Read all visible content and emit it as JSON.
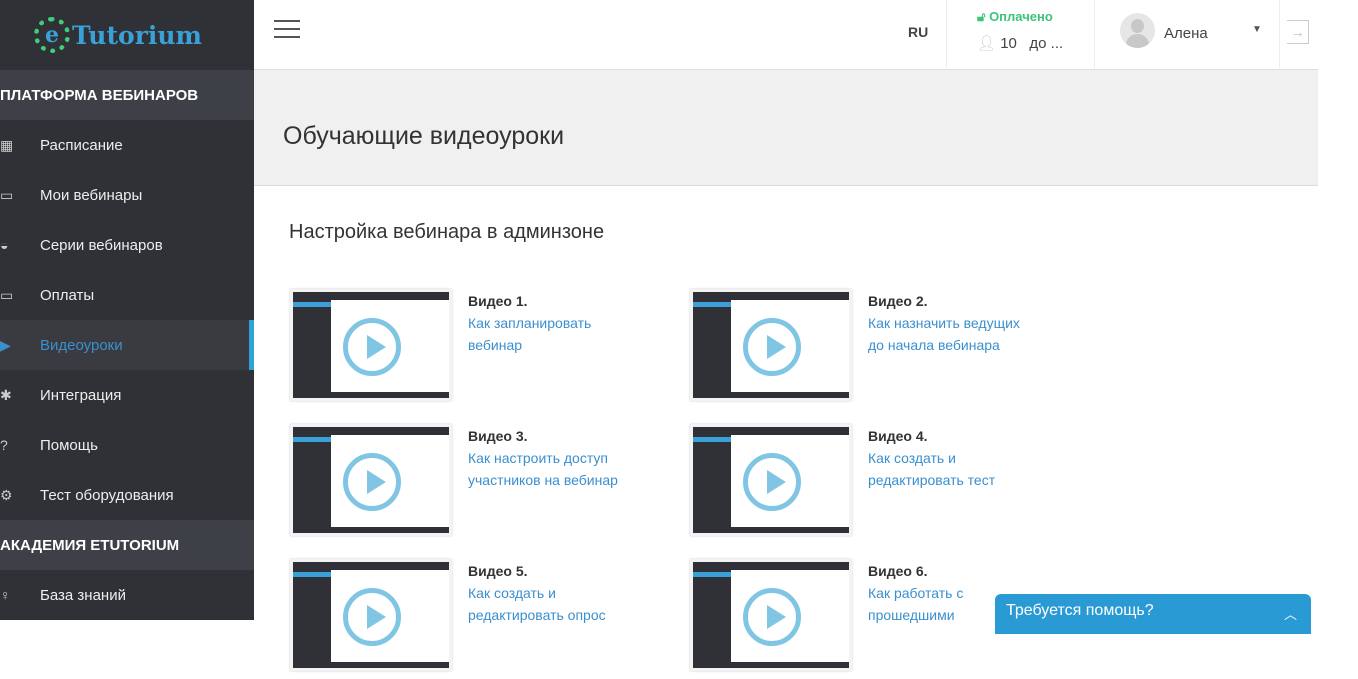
{
  "brand": {
    "logo_letter": "e",
    "name": "Tutorium"
  },
  "sidebar": {
    "section1": "ПЛАТФОРМА ВЕБИНАРОВ",
    "items": [
      {
        "label": "Расписание",
        "icon": "calendar-icon",
        "glyph": "▦"
      },
      {
        "label": "Мои вебинары",
        "icon": "monitor-icon",
        "glyph": "▭"
      },
      {
        "label": "Серии вебинаров",
        "icon": "graduation-cap-icon",
        "glyph": "◒"
      },
      {
        "label": "Оплаты",
        "icon": "wallet-icon",
        "glyph": "▭"
      },
      {
        "label": "Видеоуроки",
        "icon": "video-icon",
        "glyph": "▶"
      },
      {
        "label": "Интеграция",
        "icon": "puzzle-icon",
        "glyph": "✱"
      },
      {
        "label": "Помощь",
        "icon": "question-icon",
        "glyph": "?"
      },
      {
        "label": "Тест оборудования",
        "icon": "gear-icon",
        "glyph": "⚙"
      }
    ],
    "section2": "АКАДЕМИЯ ETUTORIUM",
    "items2": [
      {
        "label": "База знаний",
        "icon": "lightbulb-icon",
        "glyph": "♀"
      }
    ]
  },
  "header": {
    "lang": "RU",
    "status": "Оплачено",
    "users": "10",
    "until": "до ...",
    "user": "Алена"
  },
  "page": {
    "title": "Обучающие видеоуроки",
    "section": "Настройка вебинара в админзоне"
  },
  "videos": [
    {
      "num": "Видео 1.",
      "title": "Как запланировать вебинар"
    },
    {
      "num": "Видео 2.",
      "title": "Как назначить ведущих до начала вебинара"
    },
    {
      "num": "Видео 3.",
      "title": "Как настроить доступ участников на вебинар"
    },
    {
      "num": "Видео 4.",
      "title": "Как создать и редактировать тест"
    },
    {
      "num": "Видео 5.",
      "title": "Как создать и редактировать опрос"
    },
    {
      "num": "Видео 6.",
      "title": "Как работать с прошедшими"
    }
  ],
  "help": {
    "label": "Требуется помощь?"
  }
}
